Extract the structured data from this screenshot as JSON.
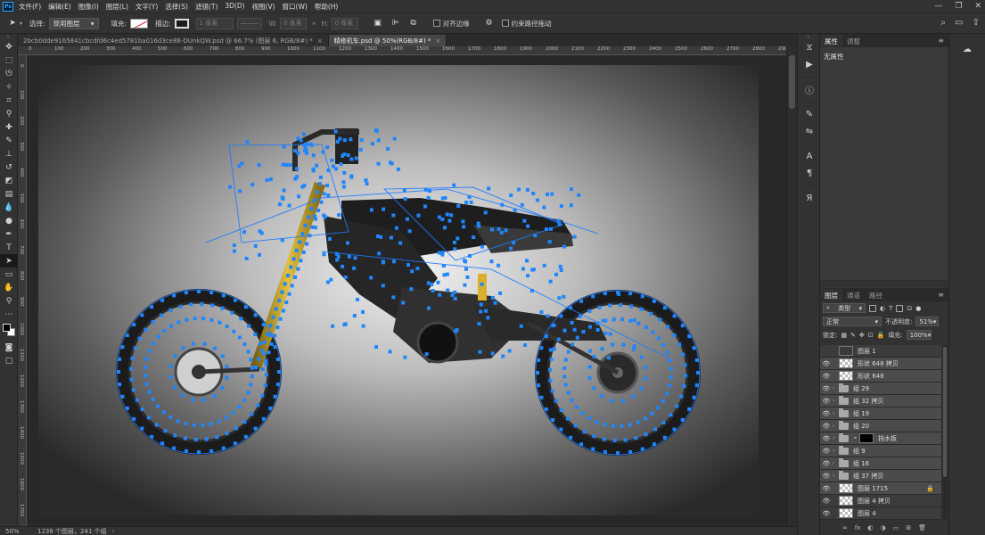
{
  "app": {
    "logo": "Ps"
  },
  "menu": [
    "文件(F)",
    "编辑(E)",
    "图像(I)",
    "图层(L)",
    "文字(Y)",
    "选择(S)",
    "滤镜(T)",
    "3D(D)",
    "视图(V)",
    "窗口(W)",
    "帮助(H)"
  ],
  "window_controls": [
    "—",
    "❐",
    "✕"
  ],
  "options": {
    "select_label": "选择:",
    "select_value": "现用图层",
    "fill_label": "填充:",
    "stroke_label": "描边:",
    "stroke_width": "1 像素",
    "width_label": "W:",
    "width_value": "0 像素",
    "height_label": "H:",
    "height_value": "0 像素",
    "align_edges": "对齐边缘",
    "constrain_path": "约束路径拖动"
  },
  "tabs": [
    {
      "label": "2bcb0dde9165841cbcdfd6c4ed5781ba016d3ce88-DUnkQW.psd @ 66.7% (图层 6, RGB/8#) *",
      "active": false
    },
    {
      "label": "精修机车.psd @ 50%(RGB/8#) *",
      "active": true
    }
  ],
  "ruler": {
    "h": [
      "0",
      "100",
      "200",
      "300",
      "400",
      "500",
      "600",
      "700",
      "800",
      "900",
      "1000",
      "1100",
      "1200",
      "1300",
      "1400",
      "1500",
      "1600",
      "1700",
      "1800",
      "1900",
      "2000",
      "2100",
      "2200",
      "2300",
      "2400",
      "2500",
      "2600",
      "2700",
      "2800",
      "2900",
      "3000"
    ],
    "v": [
      "0",
      "100",
      "200",
      "300",
      "400",
      "500",
      "600",
      "700",
      "800",
      "900",
      "1000",
      "1100",
      "1200",
      "1300",
      "1400",
      "1500",
      "1600",
      "1700"
    ]
  },
  "status": {
    "zoom": "50%",
    "info": "1238 个图层，241 个组"
  },
  "properties": {
    "tabs": [
      "属性",
      "调整"
    ],
    "body": "无属性"
  },
  "layers_panel": {
    "tabs": [
      "图层",
      "通道",
      "路径"
    ],
    "filter_label": "类型",
    "blend_mode": "正常",
    "opacity_label": "不透明度:",
    "opacity_value": "51%",
    "lock_label": "锁定:",
    "fill_label": "填充:",
    "fill_value": "100%",
    "items": [
      {
        "name": "图层 1",
        "type": "image-dark",
        "visible": false,
        "selected": false,
        "locked": false
      },
      {
        "name": "形状 648 拷贝",
        "type": "shape",
        "visible": true,
        "selected": true,
        "locked": false
      },
      {
        "name": "形状 648",
        "type": "shape",
        "visible": true,
        "selected": true,
        "locked": false
      },
      {
        "name": "组 29",
        "type": "group",
        "visible": true,
        "selected": true,
        "locked": false
      },
      {
        "name": "组 32 拷贝",
        "type": "group",
        "visible": true,
        "selected": true,
        "locked": false
      },
      {
        "name": "组 19",
        "type": "group",
        "visible": true,
        "selected": true,
        "locked": false
      },
      {
        "name": "组 20",
        "type": "group",
        "visible": true,
        "selected": true,
        "locked": false
      },
      {
        "name": "挡水板",
        "type": "group-mask",
        "visible": true,
        "selected": true,
        "locked": false
      },
      {
        "name": "组 9",
        "type": "group",
        "visible": true,
        "selected": true,
        "locked": false
      },
      {
        "name": "组 16",
        "type": "group",
        "visible": true,
        "selected": true,
        "locked": false
      },
      {
        "name": "组 37 拷贝",
        "type": "group",
        "visible": true,
        "selected": true,
        "locked": false
      },
      {
        "name": "图层 1715",
        "type": "image",
        "visible": true,
        "selected": true,
        "locked": true
      },
      {
        "name": "图层 4 拷贝",
        "type": "image",
        "visible": true,
        "selected": false,
        "locked": false
      },
      {
        "name": "图层 4",
        "type": "image",
        "visible": true,
        "selected": false,
        "locked": false
      }
    ],
    "footer": [
      "∞",
      "fx",
      "◐",
      "◑",
      "▭",
      "⊞",
      "🗑"
    ]
  },
  "colors": {
    "accent": "#1e7bff",
    "anchor": "#1f86ff",
    "fork": "#c9a227",
    "bg": "#282828"
  }
}
